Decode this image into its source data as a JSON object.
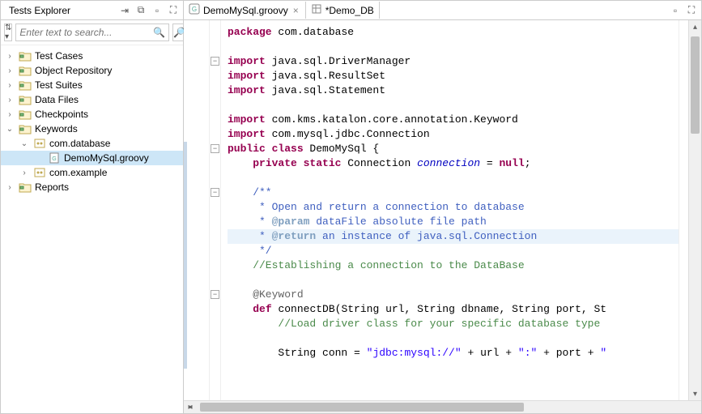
{
  "sidebar": {
    "title": "Tests Explorer",
    "search_placeholder": "Enter text to search...",
    "items": [
      {
        "label": "Test Cases",
        "indent": 0,
        "twisty": ">",
        "icon": "folder"
      },
      {
        "label": "Object Repository",
        "indent": 0,
        "twisty": ">",
        "icon": "folder"
      },
      {
        "label": "Test Suites",
        "indent": 0,
        "twisty": ">",
        "icon": "folder"
      },
      {
        "label": "Data Files",
        "indent": 0,
        "twisty": ">",
        "icon": "folder"
      },
      {
        "label": "Checkpoints",
        "indent": 0,
        "twisty": ">",
        "icon": "folder"
      },
      {
        "label": "Keywords",
        "indent": 0,
        "twisty": "v",
        "icon": "folder"
      },
      {
        "label": "com.database",
        "indent": 1,
        "twisty": "v",
        "icon": "package"
      },
      {
        "label": "DemoMySql.groovy",
        "indent": 2,
        "twisty": "",
        "icon": "file",
        "selected": true
      },
      {
        "label": "com.example",
        "indent": 1,
        "twisty": ">",
        "icon": "package"
      },
      {
        "label": "Reports",
        "indent": 0,
        "twisty": ">",
        "icon": "folder"
      }
    ]
  },
  "editor": {
    "tabs": [
      {
        "label": "DemoMySql.groovy",
        "icon": "groovy",
        "active": true,
        "dirty": false
      },
      {
        "label": "*Demo_DB",
        "icon": "data",
        "active": false,
        "dirty": true
      }
    ]
  },
  "code": {
    "lines": [
      {
        "segs": [
          {
            "t": "package ",
            "c": "kw-pink"
          },
          {
            "t": "com.database",
            "c": "ident"
          }
        ]
      },
      {
        "segs": []
      },
      {
        "segs": [
          {
            "t": "import ",
            "c": "kw-pink"
          },
          {
            "t": "java.sql.DriverManager",
            "c": "ident"
          }
        ],
        "fold": "-"
      },
      {
        "segs": [
          {
            "t": "import ",
            "c": "kw-pink"
          },
          {
            "t": "java.sql.ResultSet",
            "c": "ident"
          }
        ]
      },
      {
        "segs": [
          {
            "t": "import ",
            "c": "kw-pink"
          },
          {
            "t": "java.sql.Statement",
            "c": "ident"
          }
        ]
      },
      {
        "segs": []
      },
      {
        "segs": [
          {
            "t": "import ",
            "c": "kw-pink"
          },
          {
            "t": "com.kms.katalon.core.annotation.Keyword",
            "c": "ident"
          }
        ]
      },
      {
        "segs": [
          {
            "t": "import ",
            "c": "kw-pink"
          },
          {
            "t": "com.mysql.jdbc.Connection",
            "c": "ident"
          }
        ]
      },
      {
        "segs": [
          {
            "t": "public class ",
            "c": "kw-pink"
          },
          {
            "t": "DemoMySql {",
            "c": "ident"
          }
        ],
        "fold": "-",
        "diffStart": true
      },
      {
        "segs": [
          {
            "t": "    ",
            "c": ""
          },
          {
            "t": "private static ",
            "c": "kw-pink"
          },
          {
            "t": "Connection ",
            "c": "type"
          },
          {
            "t": "connection",
            "c": "italic-blue"
          },
          {
            "t": " = ",
            "c": ""
          },
          {
            "t": "null",
            "c": "kw-pink"
          },
          {
            "t": ";",
            "c": ""
          }
        ]
      },
      {
        "segs": []
      },
      {
        "segs": [
          {
            "t": "    /**",
            "c": "doc"
          }
        ],
        "fold": "-"
      },
      {
        "segs": [
          {
            "t": "     * Open and return a connection to database",
            "c": "doc"
          }
        ]
      },
      {
        "segs": [
          {
            "t": "     * ",
            "c": "doc"
          },
          {
            "t": "@param",
            "c": "doctag"
          },
          {
            "t": " dataFile absolute file path",
            "c": "doc"
          }
        ]
      },
      {
        "segs": [
          {
            "t": "     * ",
            "c": "doc"
          },
          {
            "t": "@return",
            "c": "doctag"
          },
          {
            "t": " an instance of java.sql.Connection",
            "c": "doc"
          }
        ],
        "hl": true
      },
      {
        "segs": [
          {
            "t": "     */",
            "c": "doc"
          }
        ]
      },
      {
        "segs": [
          {
            "t": "    //Establishing a connection to the DataBase",
            "c": "comment"
          }
        ]
      },
      {
        "segs": []
      },
      {
        "segs": [
          {
            "t": "    @Keyword",
            "c": "ann"
          }
        ],
        "fold": "-"
      },
      {
        "segs": [
          {
            "t": "    ",
            "c": ""
          },
          {
            "t": "def ",
            "c": "kw-pink"
          },
          {
            "t": "connectDB",
            "c": "ident"
          },
          {
            "t": "(String url, String dbname, String port, St",
            "c": "ident"
          }
        ]
      },
      {
        "segs": [
          {
            "t": "        //Load driver class for your specific database type",
            "c": "comment"
          }
        ]
      },
      {
        "segs": []
      },
      {
        "segs": [
          {
            "t": "        String conn = ",
            "c": "ident"
          },
          {
            "t": "\"jdbc:mysql://\"",
            "c": "string"
          },
          {
            "t": " + url + ",
            "c": "ident"
          },
          {
            "t": "\":\"",
            "c": "string"
          },
          {
            "t": " + port + ",
            "c": "ident"
          },
          {
            "t": "\"",
            "c": "string"
          }
        ]
      },
      {
        "segs": []
      }
    ]
  }
}
